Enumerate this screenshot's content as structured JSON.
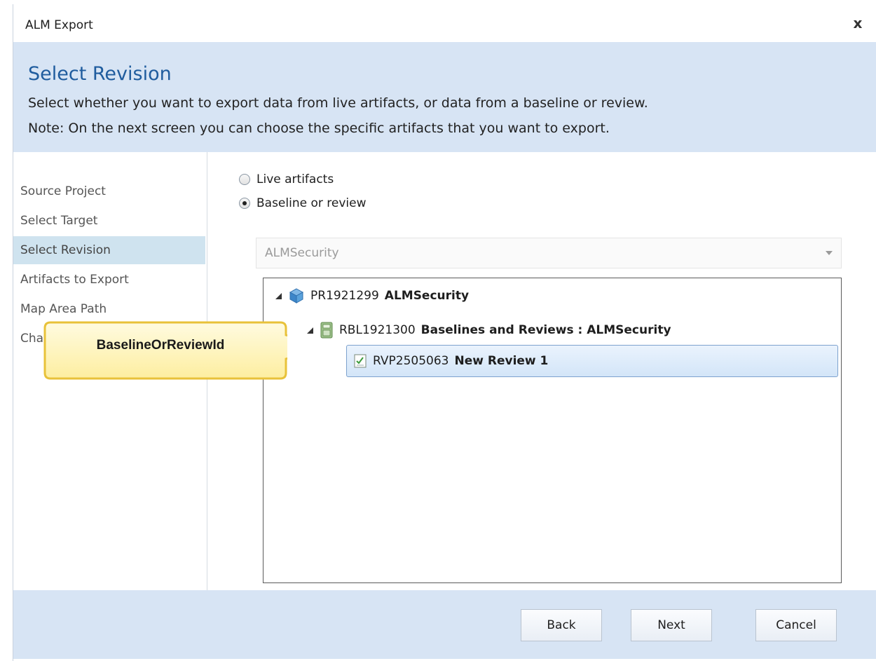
{
  "window": {
    "title": "ALM Export",
    "close_glyph": "x"
  },
  "header": {
    "title": "Select Revision",
    "description": "Select whether you want to export data from live artifacts, or data from a baseline or review.",
    "note": "Note:  On the next screen you can choose the specific artifacts that you want to export."
  },
  "steps": [
    {
      "label": "Source Project"
    },
    {
      "label": "Select Target"
    },
    {
      "label": "Select Revision",
      "active": true
    },
    {
      "label": "Artifacts to Export"
    },
    {
      "label": "Map Area Path"
    },
    {
      "label": "Cha"
    }
  ],
  "options": {
    "live": "Live artifacts",
    "baseline": "Baseline or review",
    "selected": "baseline"
  },
  "dropdown": {
    "value": "ALMSecurity"
  },
  "tree": {
    "nodes": [
      {
        "id": "PR1921299",
        "name": "ALMSecurity",
        "icon": "cube-icon",
        "level": 0
      },
      {
        "id": "RBL1921300",
        "name": "Baselines and Reviews : ALMSecurity",
        "icon": "folder-icon",
        "level": 1
      },
      {
        "id": "RVP2505063",
        "name": "New Review 1",
        "icon": "review-icon",
        "level": 2,
        "selected": true
      }
    ]
  },
  "callout": {
    "text": "BaselineOrReviewId",
    "fill": "#fdf5c0",
    "border": "#e8c23a"
  },
  "buttons": {
    "back": "Back",
    "next": "Next",
    "cancel": "Cancel"
  },
  "colors": {
    "header_bg": "#d7e4f4",
    "title_blue": "#1f5c9e",
    "active_step": "#cfe3ef"
  }
}
